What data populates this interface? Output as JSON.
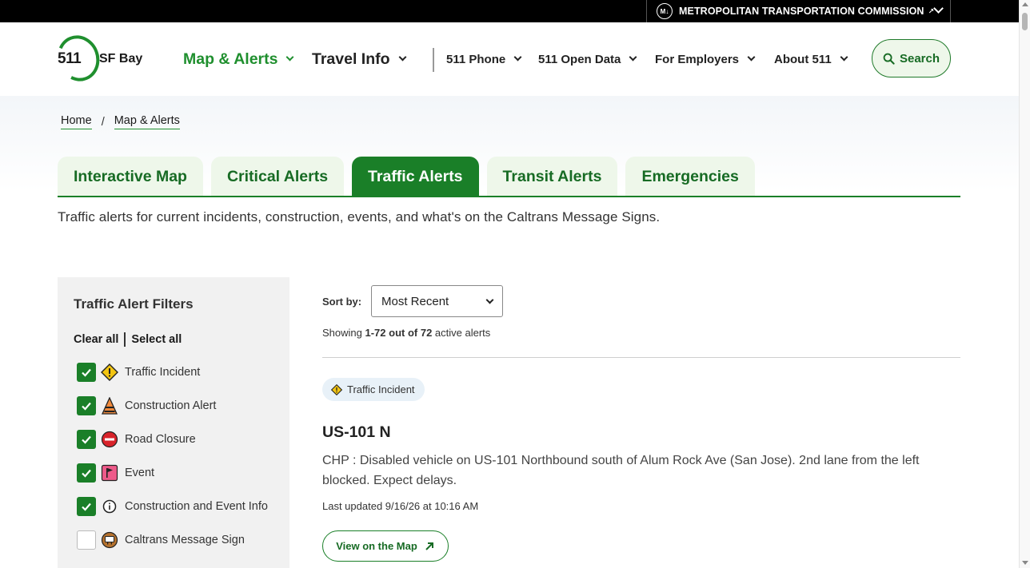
{
  "topbar": {
    "org_label": "METROPOLITAN TRANSPORTATION COMMISSION",
    "org_logo_text": "M↓"
  },
  "header": {
    "logo_number": "511",
    "logo_region": "SF Bay",
    "nav_primary": [
      {
        "label": "Map & Alerts",
        "color": "#1f8f2e"
      },
      {
        "label": "Travel Info",
        "color": "#222222"
      }
    ],
    "nav_secondary": [
      {
        "label": "511 Phone"
      },
      {
        "label": "511 Open Data"
      },
      {
        "label": "For Employers"
      },
      {
        "label": "About 511"
      }
    ],
    "search_label": "Search"
  },
  "breadcrumb": {
    "items": [
      "Home",
      "Map & Alerts"
    ],
    "separator": "/"
  },
  "tabs": [
    {
      "label": "Interactive Map",
      "active": false
    },
    {
      "label": "Critical Alerts",
      "active": false
    },
    {
      "label": "Traffic Alerts",
      "active": true
    },
    {
      "label": "Transit Alerts",
      "active": false
    },
    {
      "label": "Emergencies",
      "active": false
    }
  ],
  "intro_text": "Traffic alerts for current incidents, construction, events, and what's on the Caltrans Message Signs.",
  "filters": {
    "title": "Traffic Alert Filters",
    "clear_all": "Clear all",
    "select_all": "Select all",
    "items": [
      {
        "label": "Traffic Incident",
        "checked": true,
        "icon": "traffic-incident-icon"
      },
      {
        "label": "Construction Alert",
        "checked": true,
        "icon": "construction-alert-icon"
      },
      {
        "label": "Road Closure",
        "checked": true,
        "icon": "road-closure-icon"
      },
      {
        "label": "Event",
        "checked": true,
        "icon": "event-flag-icon"
      },
      {
        "label": "Construction and Event Info",
        "checked": true,
        "icon": "info-icon"
      },
      {
        "label": "Caltrans Message Sign",
        "checked": false,
        "icon": "message-sign-icon"
      }
    ]
  },
  "results": {
    "sort_label": "Sort by:",
    "sort_value": "Most Recent",
    "showing_prefix": "Showing",
    "showing_range": "1-72 out of 72",
    "showing_suffix": "active alerts"
  },
  "alert": {
    "category": "Traffic Incident",
    "title": "US-101 N",
    "description": "CHP : Disabled vehicle on US-101 Northbound south of Alum Rock Ave (San Jose). 2nd lane from the left blocked. Expect delays.",
    "updated": "Last updated 9/16/26 at 10:16 AM",
    "map_button": "View on the Map"
  },
  "colors": {
    "brand_green": "#1a7f28",
    "tab_inactive_bg": "#eef7ea",
    "panel_bg": "#f1f1f1"
  }
}
